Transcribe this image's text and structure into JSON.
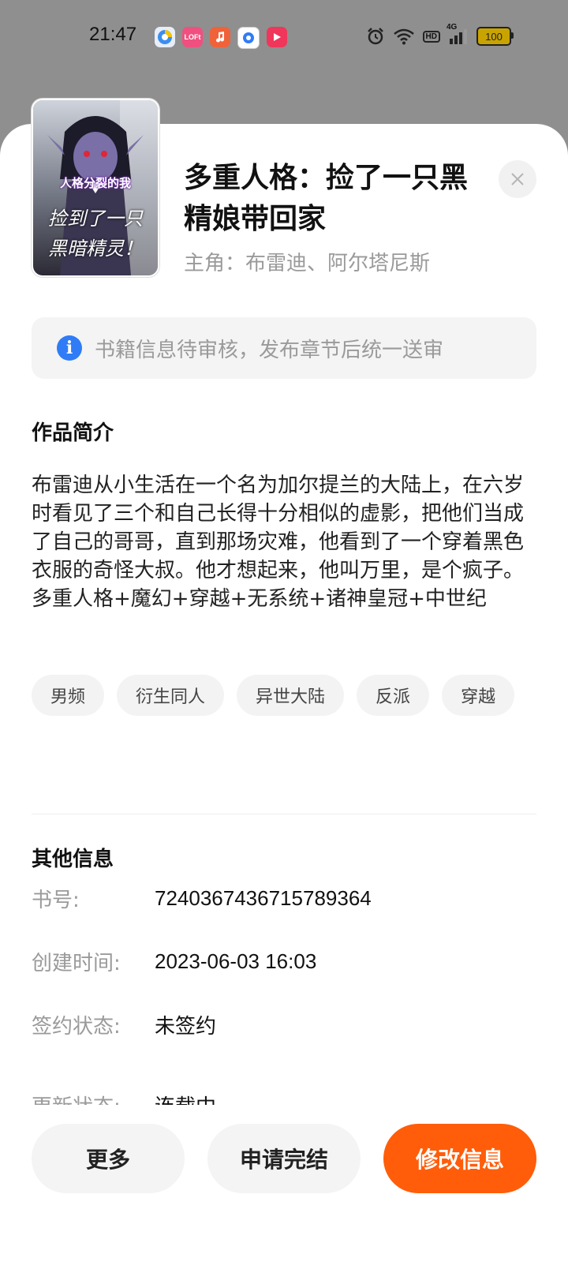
{
  "status_bar": {
    "time": "21:47",
    "app_icons": [
      "browser-icon",
      "lofter-icon",
      "music-icon",
      "camera-icon",
      "video-icon"
    ],
    "lofter_text": "LOFt",
    "network": "4G",
    "hd_label": "HD",
    "battery": "100"
  },
  "book": {
    "title": "多重人格：捡了一只黑精娘带回家",
    "protagonist": "主角：布雷迪、阿尔塔尼斯",
    "cover_text_top": "人格分裂的我",
    "cover_text_main_1": "捡到了一只",
    "cover_text_main_2": "黑暗精灵！"
  },
  "notice": {
    "text": "书籍信息待审核，发布章节后统一送审"
  },
  "synopsis": {
    "heading": "作品简介",
    "body": "布雷迪从小生活在一个名为加尔提兰的大陆上，在六岁时看见了三个和自己长得十分相似的虚影，把他们当成了自己的哥哥，直到那场灾难，他看到了一个穿着黑色衣服的奇怪大叔。他才想起来，他叫万里，是个疯子。\n多重人格+魔幻+穿越+无系统+诸神皇冠+中世纪"
  },
  "tags": [
    "男频",
    "衍生同人",
    "异世大陆",
    "反派",
    "穿越"
  ],
  "other_info": {
    "heading": "其他信息",
    "rows": [
      {
        "label": "书号:",
        "value": "7240367436715789364"
      },
      {
        "label": "创建时间:",
        "value": "2023-06-03 16:03"
      },
      {
        "label": "签约状态:",
        "value": "未签约"
      },
      {
        "label": "更新状态:",
        "value": "连载中"
      }
    ]
  },
  "actions": {
    "more": "更多",
    "apply_complete": "申请完结",
    "edit_info": "修改信息"
  },
  "colors": {
    "primary": "#ff5d0a",
    "info_blue": "#2f7cf6",
    "overlay": "#8f8f8f"
  }
}
